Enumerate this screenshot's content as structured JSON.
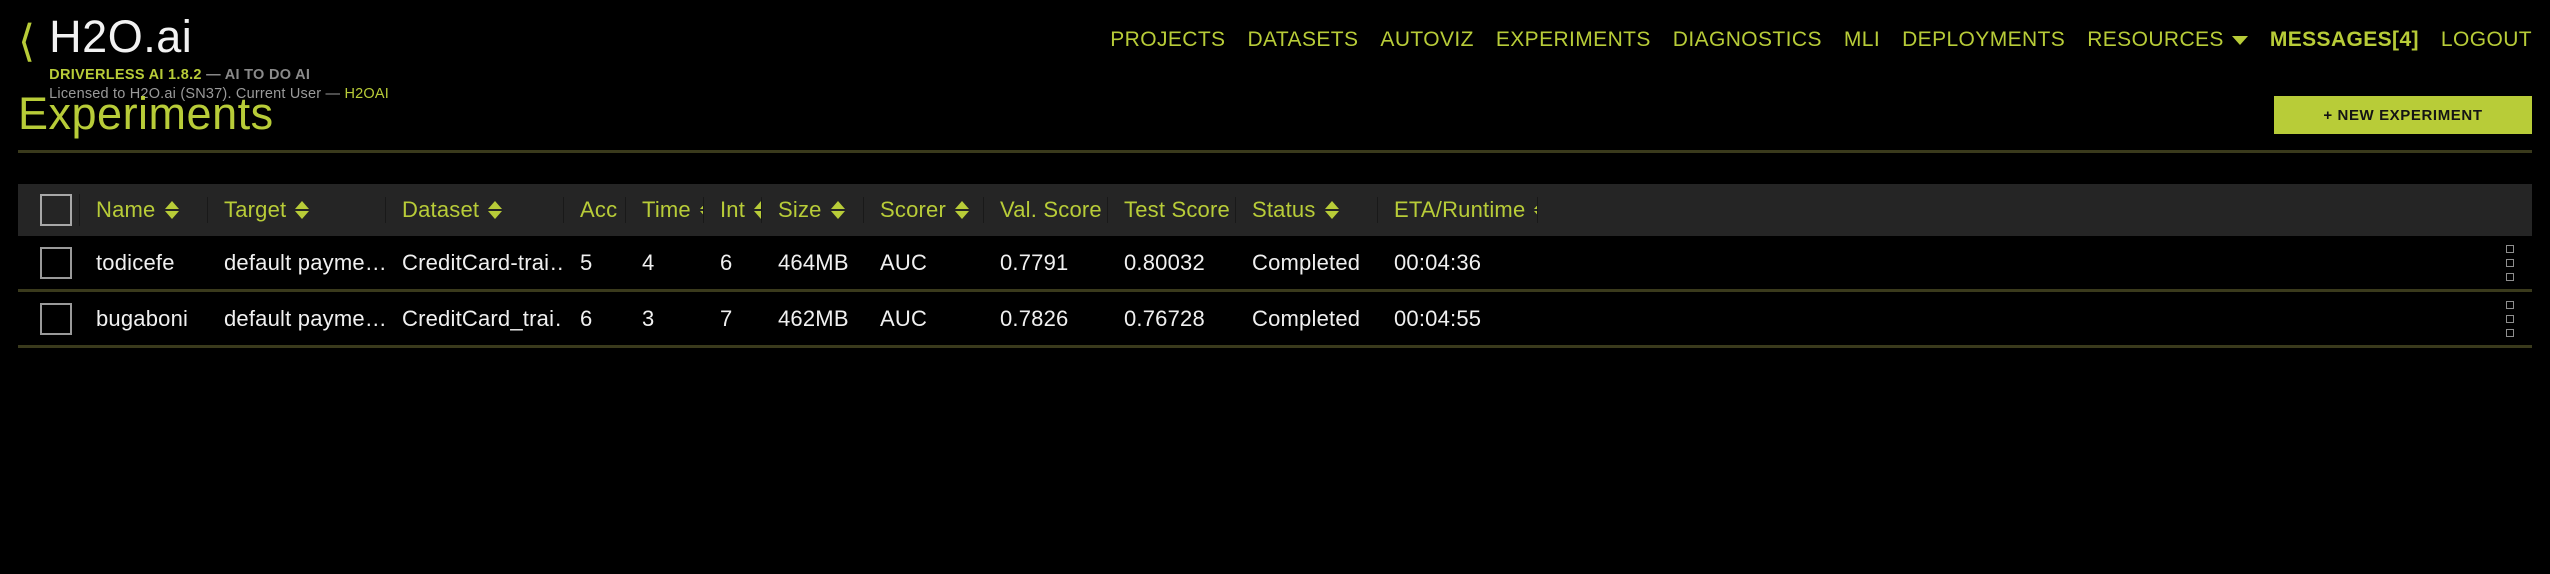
{
  "header": {
    "back_icon": "chevron-left-icon",
    "brand_title": "H2O.ai",
    "product_line_prefix": "DRIVERLESS AI 1.8.2",
    "product_line_suffix": " — AI TO DO AI",
    "license_prefix": "Licensed to H2O.ai (SN37). Current User — ",
    "license_user": "H2OAI"
  },
  "nav": {
    "items": [
      {
        "label": "PROJECTS",
        "bold": false
      },
      {
        "label": "DATASETS",
        "bold": false
      },
      {
        "label": "AUTOVIZ",
        "bold": false
      },
      {
        "label": "EXPERIMENTS",
        "bold": false
      },
      {
        "label": "DIAGNOSTICS",
        "bold": false
      },
      {
        "label": "MLI",
        "bold": false
      },
      {
        "label": "DEPLOYMENTS",
        "bold": false
      }
    ],
    "resources_label": "RESOURCES",
    "resources_caret": "chevron-down-icon",
    "messages_label": "MESSAGES[4]",
    "logout_label": "LOGOUT"
  },
  "page": {
    "title": "Experiments",
    "new_experiment_label": "+ NEW EXPERIMENT",
    "accent_color": "#b8cc38"
  },
  "table": {
    "columns": [
      {
        "key": "name",
        "label": "Name"
      },
      {
        "key": "target",
        "label": "Target"
      },
      {
        "key": "dataset",
        "label": "Dataset"
      },
      {
        "key": "acc",
        "label": "Acc"
      },
      {
        "key": "time",
        "label": "Time"
      },
      {
        "key": "int",
        "label": "Int"
      },
      {
        "key": "size",
        "label": "Size"
      },
      {
        "key": "scorer",
        "label": "Scorer"
      },
      {
        "key": "val",
        "label": "Val. Score"
      },
      {
        "key": "test",
        "label": "Test Score"
      },
      {
        "key": "status",
        "label": "Status"
      },
      {
        "key": "eta",
        "label": "ETA/Runtime"
      }
    ],
    "rows": [
      {
        "name": "todicefe",
        "target": "default payme…",
        "dataset": "CreditCard-trai…",
        "acc": "5",
        "time": "4",
        "int": "6",
        "size": "464MB",
        "scorer": "AUC",
        "val": "0.7791",
        "test": "0.80032",
        "status": "Completed",
        "eta": "00:04:36"
      },
      {
        "name": "bugaboni",
        "target": "default payme…",
        "dataset": "CreditCard_trai…",
        "acc": "6",
        "time": "3",
        "int": "7",
        "size": "462MB",
        "scorer": "AUC",
        "val": "0.7826",
        "test": "0.76728",
        "status": "Completed",
        "eta": "00:04:55"
      }
    ]
  }
}
